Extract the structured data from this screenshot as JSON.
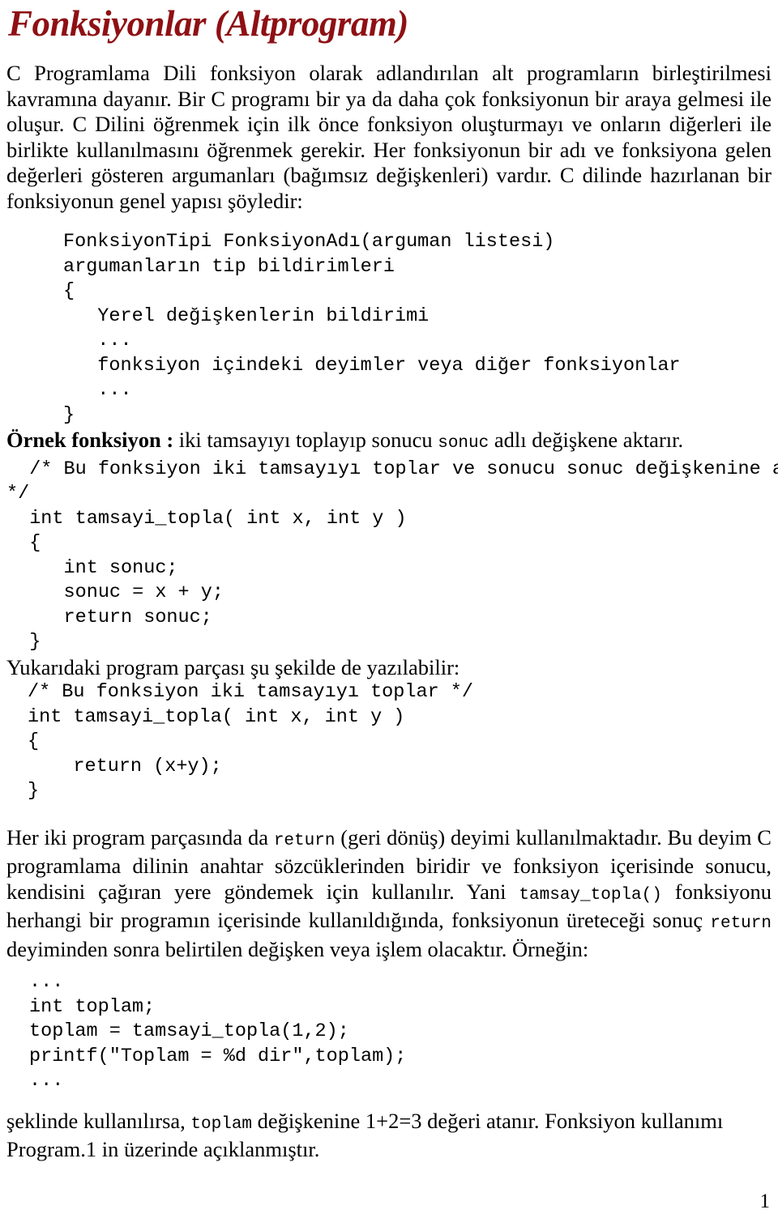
{
  "document": {
    "title": "Fonksiyonlar (Altprogram)",
    "page_number": "1",
    "accent_color": "#8e1014",
    "text_color": "#000000",
    "background_color": "#ffffff"
  },
  "paragraphs": {
    "intro": "C Programlama Dili fonksiyon olarak adlandırılan alt programların birleştirilmesi kavramına dayanır. Bir C programı bir ya da daha çok fonksiyonun bir araya gelmesi ile oluşur. C Dilini öğrenmek için ilk önce fonksiyon oluşturmayı ve onların diğerleri ile birlikte kullanılmasını öğrenmek gerekir. Her fonksiyonun bir adı ve fonksiyona gelen değerleri gösteren argumanları (bağımsız değişkenleri) vardır. C dilinde hazırlanan bir fonksiyonun genel yapısı şöyledir:",
    "ornek_label": "Örnek fonksiyon :",
    "ornek_text_1": " iki tamsayıyı toplayıp sonucu ",
    "ornek_code": "sonuc",
    "ornek_text_2": " adlı değişkene aktarır.",
    "yukaridaki": "Yukarıdaki program parçası şu şekilde de yazılabilir:",
    "return_p1": "Her iki program parçasında da ",
    "return_code_1": "return",
    "return_p2": " (geri dönüş) deyimi kullanılmaktadır. Bu deyim C programlama dilinin anahtar sözcüklerinden biridir ve fonksiyon içerisinde sonucu, kendisini çağıran yere göndemek için kullanılır. Yani ",
    "return_code_2": "tamsay_topla()",
    "return_p3": " fonksiyonu herhangi bir programın içerisinde kullanıldığında, fonksiyonun üreteceği sonuç ",
    "return_code_3": "return",
    "return_p4": " deyiminden sonra belirtilen değişken veya işlem olacaktır. Örneğin:",
    "final_p1": "şeklinde kullanılırsa, ",
    "final_code": "toplam",
    "final_p2": " değişkenine 1+2=3 değeri atanır. Fonksiyon kullanımı Program.1 in üzerinde açıklanmıştır."
  },
  "code_blocks": {
    "general_form": "FonksiyonTipi FonksiyonAdı(arguman listesi)\nargumanların tip bildirimleri\n{\n   Yerel değişkenlerin bildirimi\n   ...\n   fonksiyon içindeki deyimler veya diğer fonksiyonlar\n   ...\n}",
    "example_sum": "  /* Bu fonksiyon iki tamsayıyı toplar ve sonucu sonuc değişkenine aktarır\n*/\n  int tamsayi_topla( int x, int y )\n  {\n     int sonuc;\n     sonuc = x + y;\n     return sonuc;\n  }",
    "example_short": "/* Bu fonksiyon iki tamsayıyı toplar */\nint tamsayi_topla( int x, int y )\n{\n    return (x+y);\n}",
    "usage": "...\nint toplam;\ntoplam = tamsayi_topla(1,2);\nprintf(\"Toplam = %d dir\",toplam);\n..."
  }
}
